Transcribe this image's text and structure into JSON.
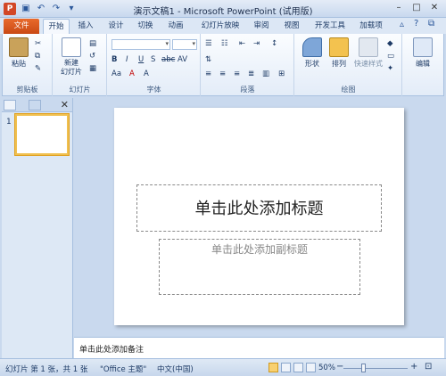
{
  "window": {
    "title": "演示文稿1 - Microsoft PowerPoint (试用版)",
    "app_icon_letter": "P"
  },
  "tabs": [
    "文件",
    "开始",
    "插入",
    "设计",
    "切换",
    "动画",
    "幻灯片放映",
    "审阅",
    "视图",
    "开发工具",
    "加载项"
  ],
  "ribbon": {
    "groups": [
      "剪贴板",
      "幻灯片",
      "字体",
      "段落",
      "绘图",
      "编辑"
    ],
    "paste": "粘贴",
    "new_slide": "新建\n幻灯片",
    "new_slide_line1": "新建",
    "new_slide_line2": "幻灯片",
    "shapes": "形状",
    "arrange": "排列",
    "quick_styles": "快速样式",
    "editing": "编辑",
    "font_buttons": [
      "B",
      "I",
      "U",
      "S",
      "abc",
      "AV",
      "Aa",
      "A",
      "A"
    ]
  },
  "slide": {
    "number": "1",
    "title_placeholder": "单击此处添加标题",
    "subtitle_placeholder": "单击此处添加副标题"
  },
  "notes": {
    "placeholder": "单击此处添加备注"
  },
  "status": {
    "slide_info": "幻灯片 第 1 张，共 1 张",
    "theme": "\"Office 主题\"",
    "language": "中文(中国)",
    "zoom": "50%"
  },
  "colors": {
    "accent": "#d24726",
    "ribbon_bg": "#e3ecf8",
    "selection": "#f0c050"
  }
}
